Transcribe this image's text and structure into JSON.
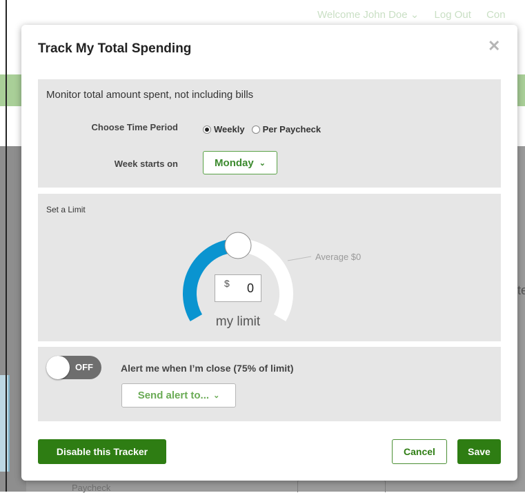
{
  "background": {
    "nav": [
      "Welcome John Doe ⌄",
      "Log Out",
      "Con"
    ],
    "side_text": "te",
    "bottom_text": "Paycheck"
  },
  "modal": {
    "title": "Track My Total Spending",
    "close_icon": "close-icon"
  },
  "time_period": {
    "description": "Monitor total amount spent, not including bills",
    "choose_label": "Choose Time Period",
    "options": [
      {
        "label": "Weekly",
        "checked": true
      },
      {
        "label": "Per Paycheck",
        "checked": false
      }
    ],
    "week_starts_label": "Week starts on",
    "week_start_value": "Monday"
  },
  "limit": {
    "section_label": "Set a Limit",
    "average_label": "Average $0",
    "currency_symbol": "$",
    "value": "0",
    "caption": "my limit",
    "gauge_fill_fraction": 0.5,
    "fill_color": "#0a94d0",
    "track_color": "#ffffff"
  },
  "alert": {
    "toggle_state": "OFF",
    "label": "Alert me when I’m close (75% of limit)",
    "send_to_label": "Send alert to..."
  },
  "buttons": {
    "disable": "Disable this Tracker",
    "cancel": "Cancel",
    "save": "Save"
  },
  "colors": {
    "primary_green": "#2e7d13",
    "link_green": "#3c8a2e"
  }
}
